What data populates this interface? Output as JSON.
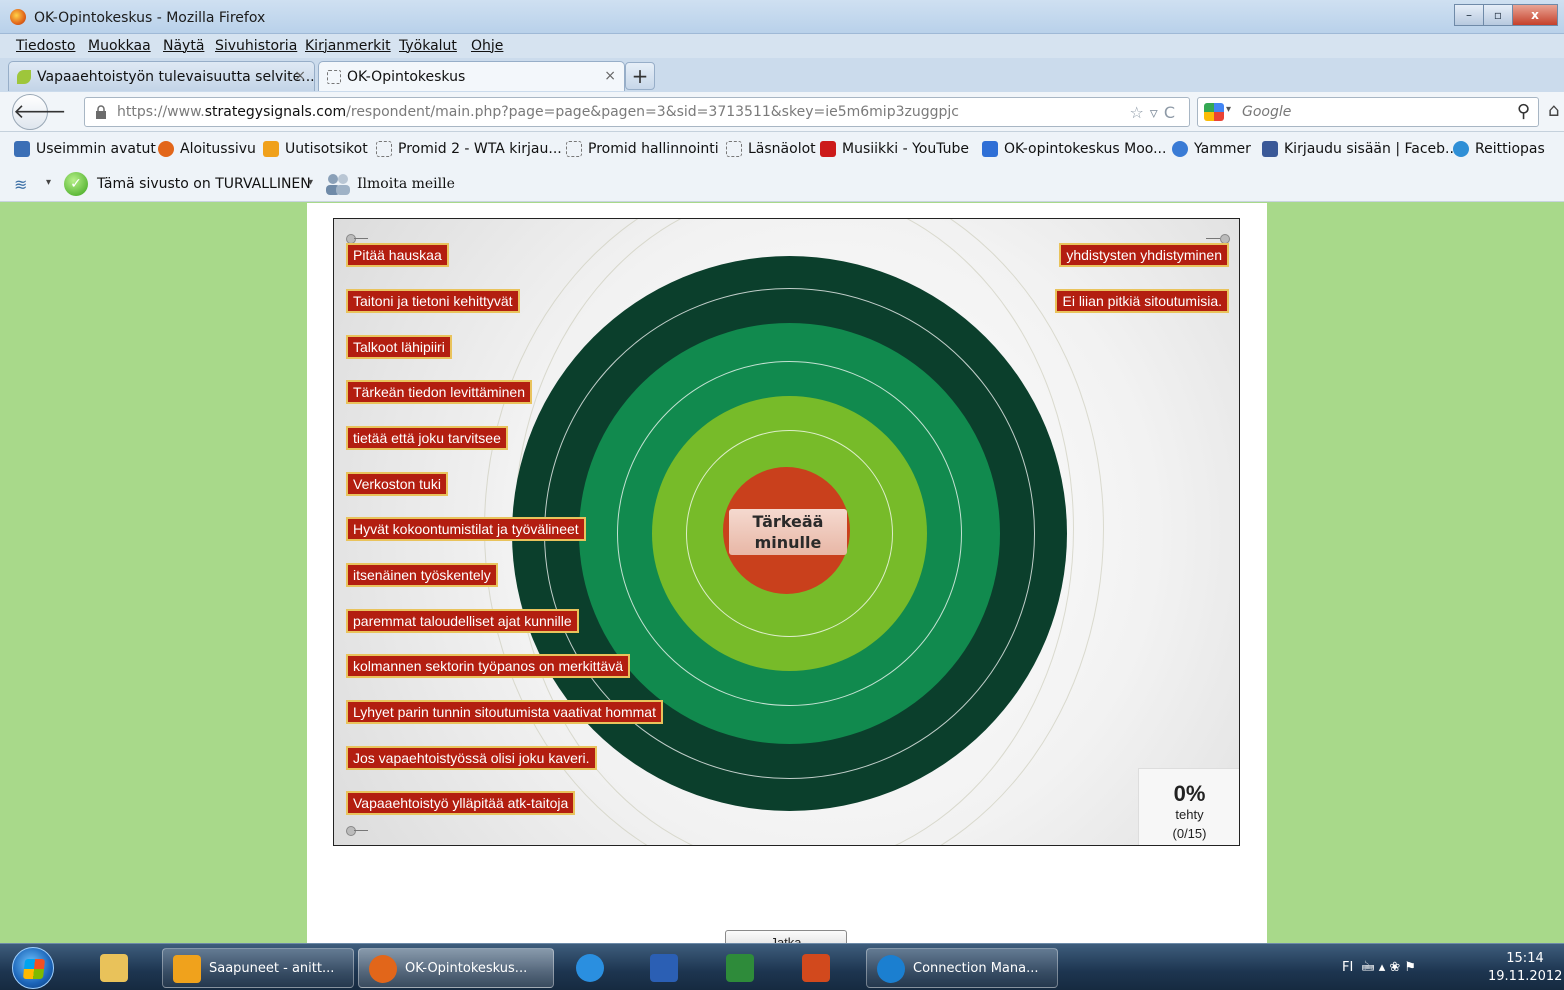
{
  "window": {
    "title": "OK-Opintokeskus - Mozilla Firefox",
    "minimize_label": "–",
    "maximize_label": "▫",
    "close_label": "x"
  },
  "menu": [
    "Tiedosto",
    "Muokkaa",
    "Näytä",
    "Sivuhistoria",
    "Kirjanmerkit",
    "Työkalut",
    "Ohje"
  ],
  "tabs": [
    {
      "label": "Vapaaehtoistyön tulevaisuutta selvite...",
      "close": "×"
    },
    {
      "label": "OK-Opintokeskus",
      "close": "×"
    }
  ],
  "new_tab_label": "+",
  "nav": {
    "back_label": "🡐",
    "url_prefix": "https://www.",
    "url_domain": "strategysignals.com",
    "url_path": "/respondent/main.php?page=page&pagen=3&sid=3713511&skey=ie5m6mip3zuggpjc",
    "url_icons": "☆▿C",
    "search_placeholder": "Google",
    "search_icon": "⚲",
    "home_icon": "⌂"
  },
  "bookmarks": [
    {
      "label": "Useimmin avatut",
      "icon": "bookmark-icon",
      "color": "#3b6fb6"
    },
    {
      "label": "Aloitussivu",
      "icon": "firefox-icon",
      "color": "#e2661a"
    },
    {
      "label": "Uutisotsikot",
      "icon": "rss-icon",
      "color": "#f0a11c"
    },
    {
      "label": "Promid 2 - WTA kirjau...",
      "icon": "page-icon",
      "color": "#ffffff"
    },
    {
      "label": "Promid hallinnointi",
      "icon": "page-icon",
      "color": "#ffffff"
    },
    {
      "label": "Läsnäolot",
      "icon": "page-icon",
      "color": "#ffffff"
    },
    {
      "label": "Musiikki - YouTube",
      "icon": "youtube-icon",
      "color": "#cc1a1a"
    },
    {
      "label": "OK-opintokeskus Moo...",
      "icon": "moodle-icon",
      "color": "#2f6fd6"
    },
    {
      "label": "Yammer",
      "icon": "yammer-icon",
      "color": "#3a7bd5"
    },
    {
      "label": "Kirjaudu sisään | Faceb...",
      "icon": "facebook-icon",
      "color": "#3b5998"
    },
    {
      "label": "Reittiopas",
      "icon": "route-icon",
      "color": "#2f8fd6"
    }
  ],
  "addon": {
    "safe_text": "Tämä sivusto on TURVALLINEN",
    "check_mark": "✓",
    "report_text": "Ilmoita meille",
    "dropdown": "▾",
    "wifi": "≋"
  },
  "survey": {
    "center_label_line1": "Tärkeää",
    "center_label_line2": "minulle",
    "ring_colors": [
      "#0b3f2c",
      "#118a4e",
      "#77bb29",
      "#c9401c"
    ],
    "items_left": [
      "Pitää hauskaa",
      "Taitoni ja tietoni kehittyvät",
      "Talkoot lähipiiri",
      "Tärkeän tiedon levittäminen",
      "tietää että joku tarvitsee",
      "Verkoston tuki",
      "Hyvät kokoontumistilat ja työvälineet",
      "itsenäinen työskentely",
      "paremmat taloudelliset ajat kunnille",
      "kolmannen sektorin työpanos on merkittävä",
      "Lyhyet parin tunnin sitoutumista vaativat hommat",
      "Jos vapaehtoistyössä olisi joku kaveri.",
      "Vapaaehtoistyö ylläpitää atk-taitoja"
    ],
    "items_right": [
      "yhdistysten yhdistyminen",
      "Ei liian pitkiä sitoutumisia."
    ],
    "progress_percent": "0%",
    "progress_done_label": "tehty",
    "progress_count": "(0/15)",
    "continue_label": "Jatka"
  },
  "taskbar": {
    "apps": [
      {
        "label": "",
        "icon": "explorer-icon",
        "color": "#e9c25a"
      },
      {
        "label": "Saapuneet - anitt...",
        "icon": "outlook-icon",
        "color": "#f0a21c"
      },
      {
        "label": "OK-Opintokeskus...",
        "icon": "firefox-icon",
        "color": "#e2661a"
      },
      {
        "label": "",
        "icon": "ie-icon",
        "color": "#2a8fe0"
      },
      {
        "label": "",
        "icon": "word-icon",
        "color": "#2b5fb4"
      },
      {
        "label": "",
        "icon": "excel-icon",
        "color": "#2e8b3a"
      },
      {
        "label": "",
        "icon": "powerpoint-icon",
        "color": "#d2491d"
      },
      {
        "label": "Connection Mana...",
        "icon": "hp-icon",
        "color": "#1b7fd0"
      }
    ],
    "tray_lang": "FI",
    "tray_icons": "🖮 ▴ ❀ ⚑",
    "time": "15:14",
    "date": "19.11.2012"
  }
}
